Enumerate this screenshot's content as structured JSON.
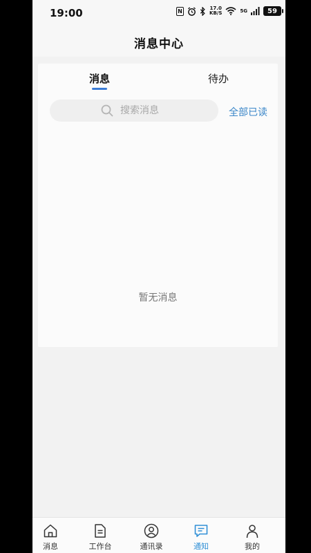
{
  "status_bar": {
    "time": "19:00",
    "nfc": "N",
    "net_speed_value": "17.0",
    "net_speed_unit": "KB/S",
    "network": "5G",
    "battery": "59"
  },
  "header": {
    "title": "消息中心"
  },
  "tabs": [
    {
      "label": "消息",
      "active": true
    },
    {
      "label": "待办",
      "active": false
    }
  ],
  "search": {
    "placeholder": "搜索消息"
  },
  "actions": {
    "mark_all_read": "全部已读"
  },
  "empty_state": {
    "text": "暂无消息"
  },
  "bottom_nav": [
    {
      "label": "消息",
      "icon": "home-icon",
      "active": false
    },
    {
      "label": "工作台",
      "icon": "document-icon",
      "active": false
    },
    {
      "label": "通讯录",
      "icon": "contact-icon",
      "active": false
    },
    {
      "label": "通知",
      "icon": "chat-icon",
      "active": true
    },
    {
      "label": "我的",
      "icon": "person-icon",
      "active": false
    }
  ],
  "colors": {
    "accent": "#3a7bd5",
    "link": "#3a86c8",
    "active_nav": "#2f8fd6"
  }
}
